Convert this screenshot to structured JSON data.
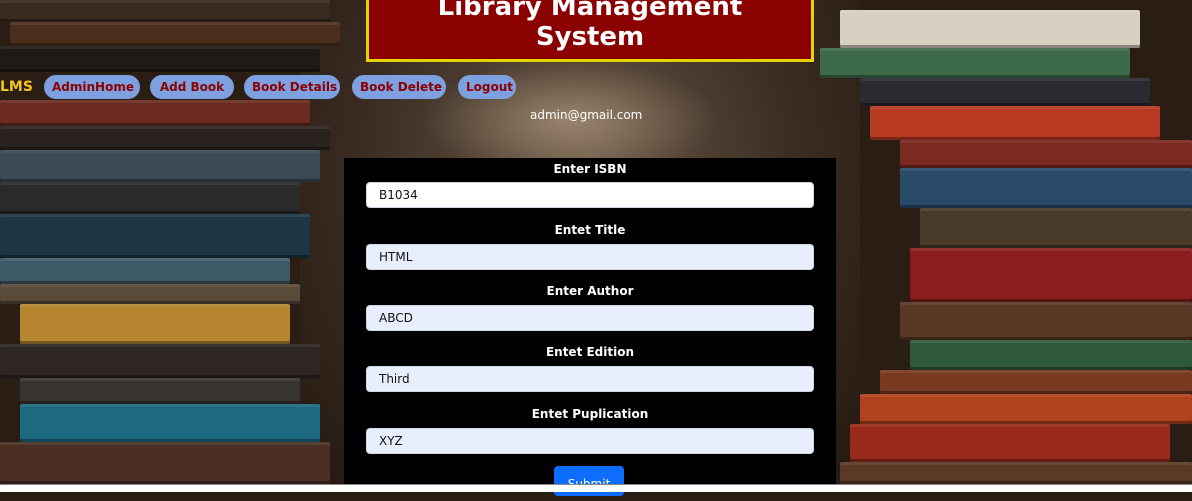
{
  "header": {
    "title_line1": "Library Management",
    "title_line2": "System"
  },
  "nav": {
    "brand": "LMS",
    "items": [
      {
        "label": "AdminHome"
      },
      {
        "label": "Add Book"
      },
      {
        "label": "Book Details"
      },
      {
        "label": "Book Delete"
      },
      {
        "label": "Logout"
      }
    ],
    "user_email": "admin@gmail.com"
  },
  "form": {
    "fields": [
      {
        "label": "Enter ISBN",
        "value": "B1034"
      },
      {
        "label": "Entet Title",
        "value": "HTML"
      },
      {
        "label": "Enter Author",
        "value": "ABCD"
      },
      {
        "label": "Entet Edition",
        "value": "Third"
      },
      {
        "label": "Entet Puplication",
        "value": "XYZ"
      }
    ],
    "submit_label": "Submit"
  },
  "colors": {
    "title_bg": "#8b0000",
    "title_border": "#e3d400",
    "nav_button_bg": "#7da0e0",
    "nav_button_text": "#8b0000",
    "brand_text": "#f5c518",
    "form_bg": "#000000",
    "submit_bg": "#0d6efd"
  }
}
